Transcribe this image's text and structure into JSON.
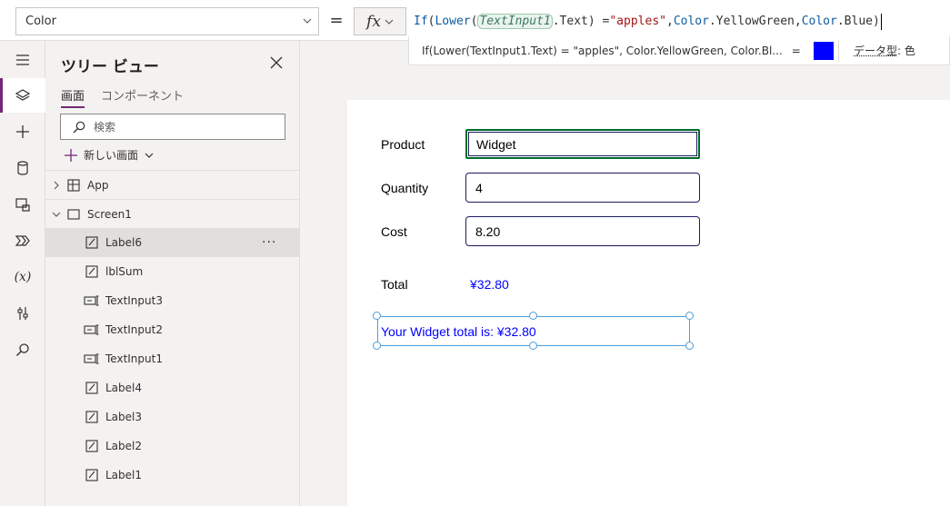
{
  "formula_bar": {
    "property": "Color",
    "fx_label": "fx",
    "tokens": {
      "if": "If",
      "p1": "(",
      "lower": "Lower",
      "p2": "(",
      "control": "TextInput1",
      "rest1": ".Text) = ",
      "str": "\"apples\"",
      "comma1": ", ",
      "color1": "Color",
      "val1": ".YellowGreen, ",
      "color2": "Color",
      "val2": ".Blue)"
    },
    "preview_text": "If(Lower(TextInput1.Text) = \"apples\", Color.YellowGreen, Color.Bl...",
    "preview_eq": "=",
    "preview_color": "#0000ff",
    "data_type_label": "データ型",
    "data_type_value": ": 色"
  },
  "tree": {
    "title": "ツリー ビュー",
    "tabs": [
      "画面",
      "コンポーネント"
    ],
    "search_placeholder": "検索",
    "new_screen": "新しい画面",
    "items": [
      {
        "label": "App",
        "icon": "app-icon"
      },
      {
        "label": "Screen1",
        "icon": "screen-icon"
      },
      {
        "label": "Label6",
        "icon": "label-icon",
        "selected": true,
        "more": "···"
      },
      {
        "label": "lblSum",
        "icon": "label-icon"
      },
      {
        "label": "TextInput3",
        "icon": "text-input-icon"
      },
      {
        "label": "TextInput2",
        "icon": "text-input-icon"
      },
      {
        "label": "TextInput1",
        "icon": "text-input-icon"
      },
      {
        "label": "Label4",
        "icon": "label-icon"
      },
      {
        "label": "Label3",
        "icon": "label-icon"
      },
      {
        "label": "Label2",
        "icon": "label-icon"
      },
      {
        "label": "Label1",
        "icon": "label-icon"
      }
    ]
  },
  "app": {
    "product_label": "Product",
    "product_value": "Widget",
    "quantity_label": "Quantity",
    "quantity_value": "4",
    "cost_label": "Cost",
    "cost_value": "8.20",
    "total_label": "Total",
    "total_value": "¥32.80",
    "message": "Your Widget total is: ¥32.80"
  },
  "colors": {
    "accent": "#742774",
    "selection": "#4e9fd8",
    "label_text": "#0000ff"
  }
}
